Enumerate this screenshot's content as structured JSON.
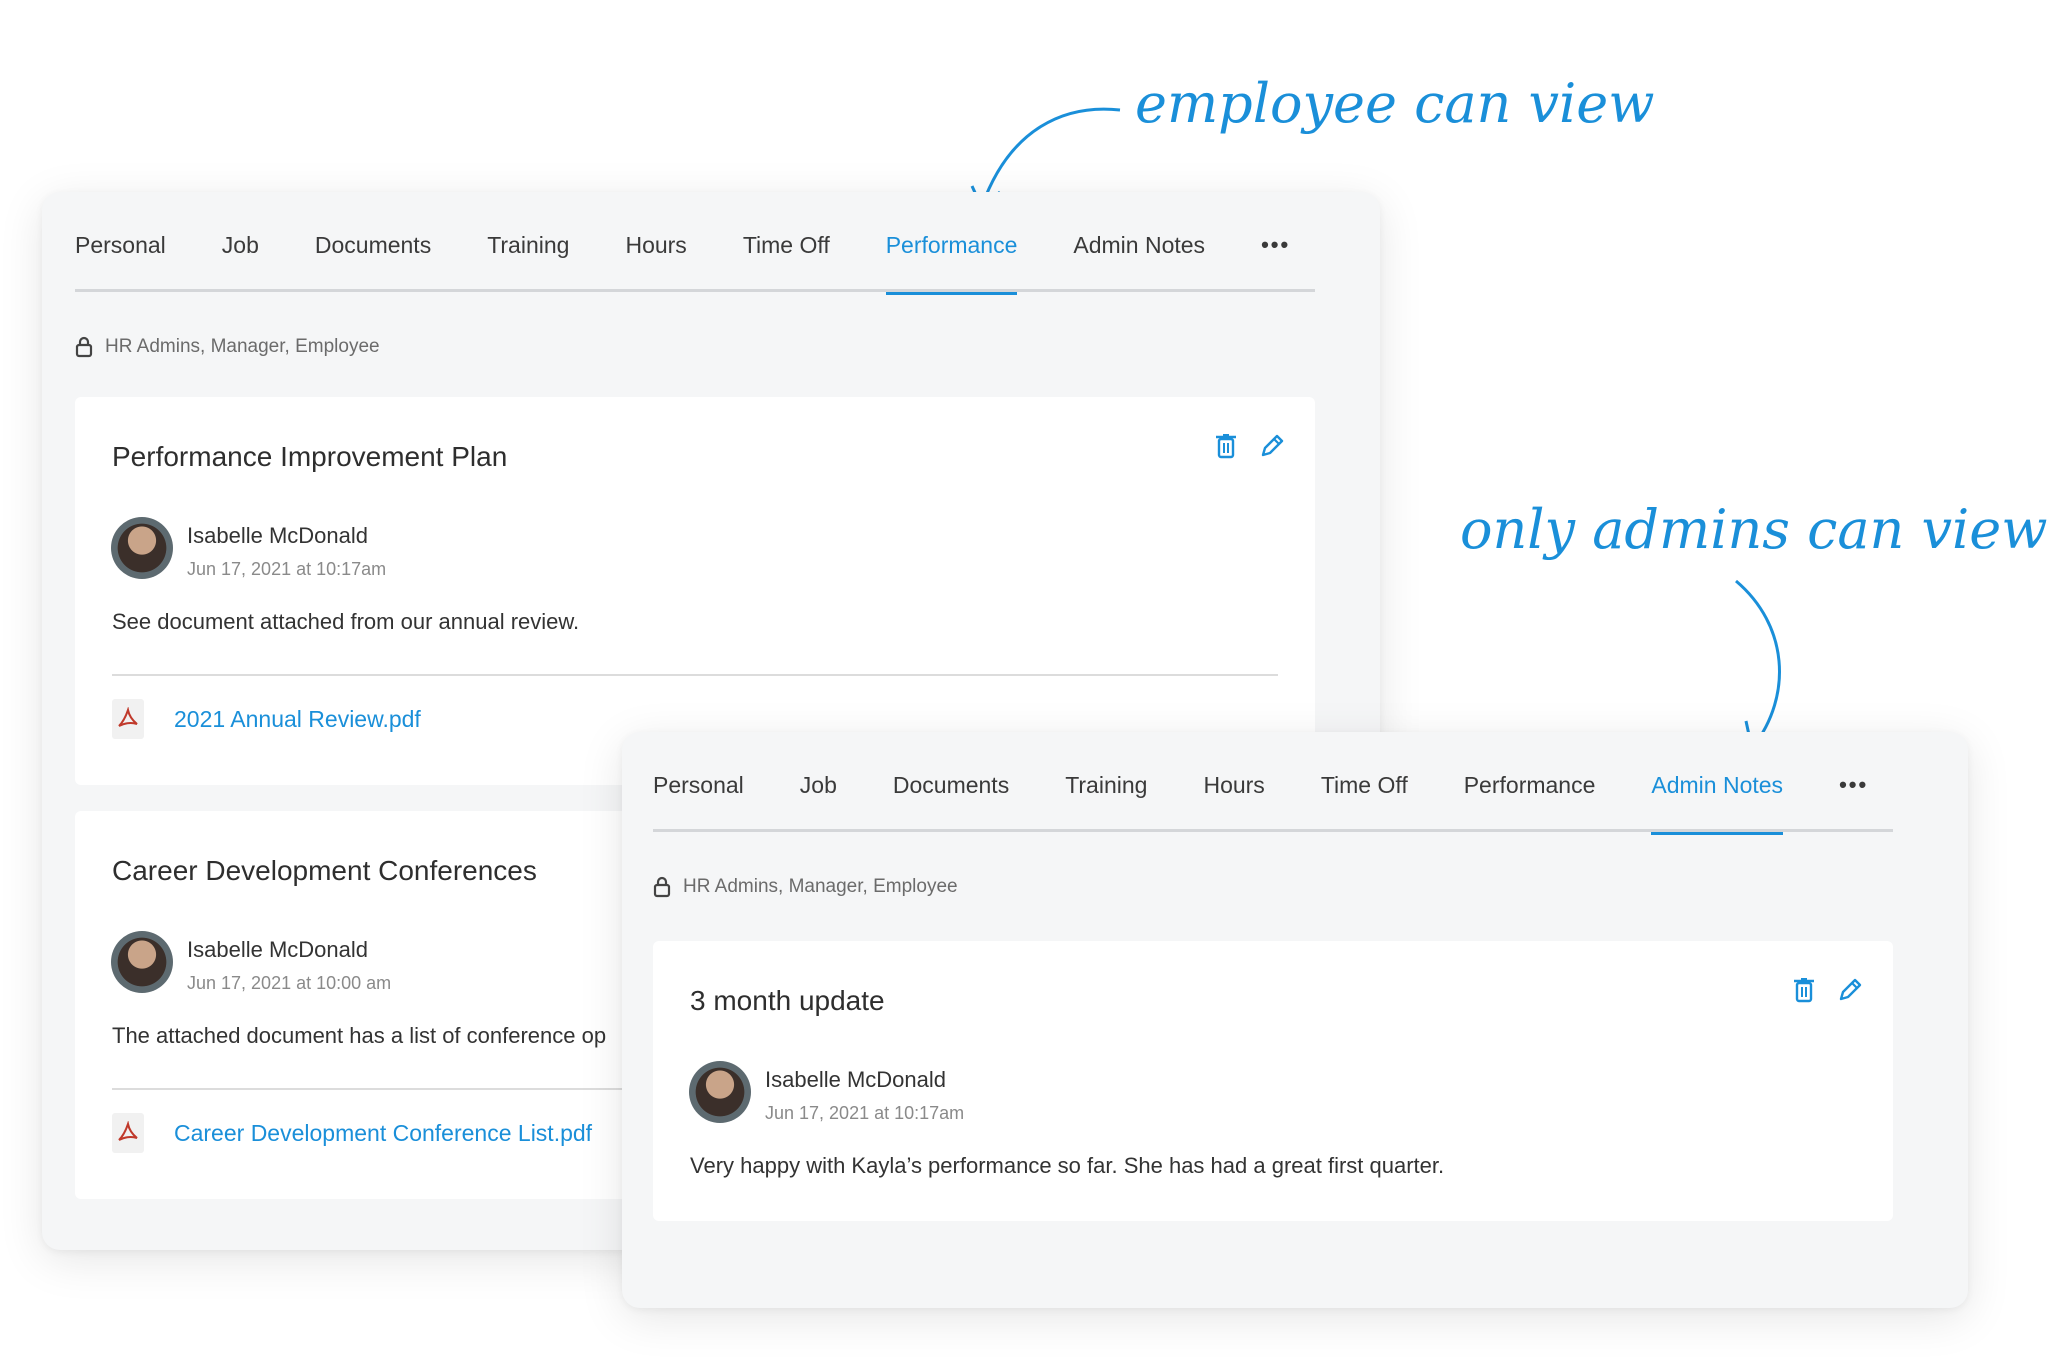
{
  "annotations": {
    "employee": "employee can view",
    "admins": "only admins can view"
  },
  "colors": {
    "accent": "#1a8fd9",
    "panel_bg": "#f5f6f7",
    "pdf_red": "#c0392b"
  },
  "back_panel": {
    "tabs": [
      {
        "label": "Personal"
      },
      {
        "label": "Job"
      },
      {
        "label": "Documents"
      },
      {
        "label": "Training"
      },
      {
        "label": "Hours"
      },
      {
        "label": "Time Off"
      },
      {
        "label": "Performance",
        "active": true
      },
      {
        "label": "Admin Notes"
      }
    ],
    "more_label": "•••",
    "access_text": "HR Admins, Manager, Employee",
    "cards": [
      {
        "title": "Performance Improvement Plan",
        "author": "Isabelle McDonald",
        "date": "Jun 17, 2021 at 10:17am",
        "text": "See document attached from our annual review.",
        "attachment": "2021 Annual Review.pdf"
      },
      {
        "title": "Career Development Conferences",
        "author": "Isabelle McDonald",
        "date": "Jun 17, 2021 at 10:00 am",
        "text": "The attached document has a list of conference op",
        "attachment": "Career Development Conference List.pdf"
      }
    ]
  },
  "front_panel": {
    "tabs": [
      {
        "label": "Personal"
      },
      {
        "label": "Job"
      },
      {
        "label": "Documents"
      },
      {
        "label": "Training"
      },
      {
        "label": "Hours"
      },
      {
        "label": "Time Off"
      },
      {
        "label": "Performance"
      },
      {
        "label": "Admin Notes",
        "active": true
      }
    ],
    "more_label": "•••",
    "access_text": "HR Admins, Manager, Employee",
    "card": {
      "title": "3 month update",
      "author": "Isabelle McDonald",
      "date": "Jun 17, 2021 at 10:17am",
      "text": "Very happy with Kayla’s performance so far. She has had a great first quarter."
    }
  }
}
